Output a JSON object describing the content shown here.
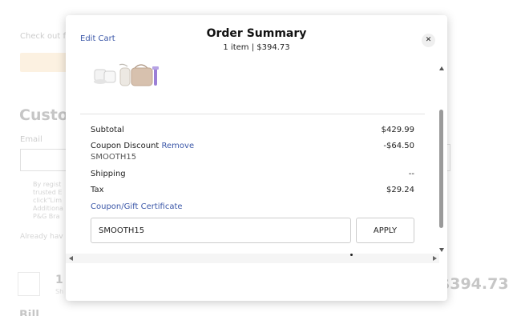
{
  "background_page": {
    "checkout_text": "Check out fa",
    "customer_heading": "Custo",
    "email_label": "Email",
    "legal_text": "By regist trusted E click\"Lim Additiona P&G Bra",
    "already_text": "Already hav",
    "qty_text": "1 I",
    "qty_sub": "Sh",
    "total": "$394.73",
    "billing_heading": "Bill"
  },
  "modal": {
    "edit_cart_label": "Edit Cart",
    "title": "Order Summary",
    "subtitle": "1 item | $394.73",
    "close_icon": "close-icon",
    "product_image": "product-bundle-image"
  },
  "summary": {
    "subtotal_label": "Subtotal",
    "subtotal_value": "$429.99",
    "coupon_label": "Coupon Discount",
    "remove_label": "Remove",
    "coupon_value": "-$64.50",
    "coupon_code": "SMOOTH15",
    "shipping_label": "Shipping",
    "shipping_value": "--",
    "tax_label": "Tax",
    "tax_value": "$29.24"
  },
  "coupon_form": {
    "link_label": "Coupon/Gift Certificate",
    "input_value": "SMOOTH15",
    "apply_label": "APPLY"
  },
  "colors": {
    "link": "#3b57a8",
    "promo": "#f7c98a"
  }
}
